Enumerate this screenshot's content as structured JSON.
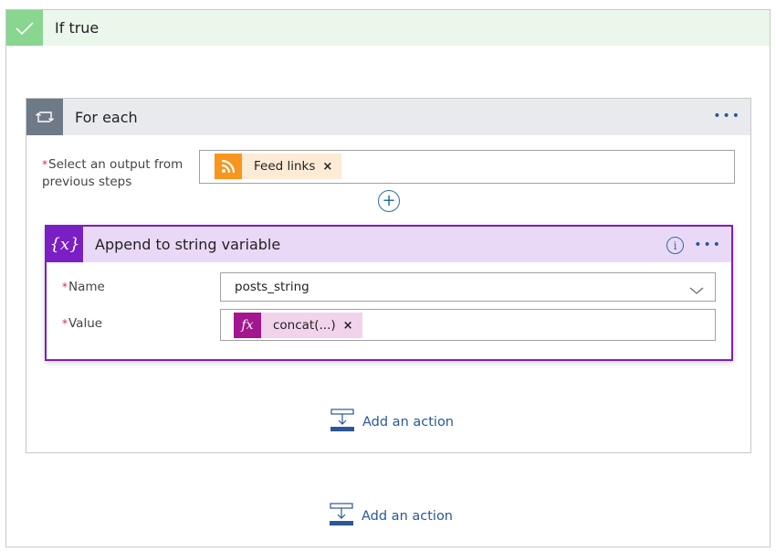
{
  "if_true": {
    "title": "If true",
    "icon": "checkmark-icon",
    "color": "#88d68f"
  },
  "for_each": {
    "title": "For each",
    "icon": "loop-icon",
    "more_label": "•••",
    "select_label_required": "*",
    "select_label": "Select an output from previous steps",
    "select_label_line1": "Select an output from",
    "select_label_line2": "previous steps",
    "token": {
      "label": "Feed links",
      "icon": "rss-icon",
      "color": "#f7951d",
      "close": "×"
    },
    "add_step_label": "+",
    "add_action_label": "Add an action"
  },
  "append_action": {
    "title": "Append to string variable",
    "icon": "variable-icon",
    "icon_glyph": "{x}",
    "color": "#7a1fc4",
    "info_glyph": "i",
    "more_label": "•••",
    "fields": {
      "name": {
        "required": "*",
        "label": "Name",
        "value": "posts_string"
      },
      "value": {
        "required": "*",
        "label": "Value",
        "token": {
          "label": "concat(...)",
          "icon": "function-icon",
          "icon_glyph": "fx",
          "color": "#a4168f",
          "close": "×"
        }
      }
    }
  },
  "add_action_label": "Add an action",
  "colors": {
    "link": "#2b5797",
    "required": "#d9284d"
  }
}
